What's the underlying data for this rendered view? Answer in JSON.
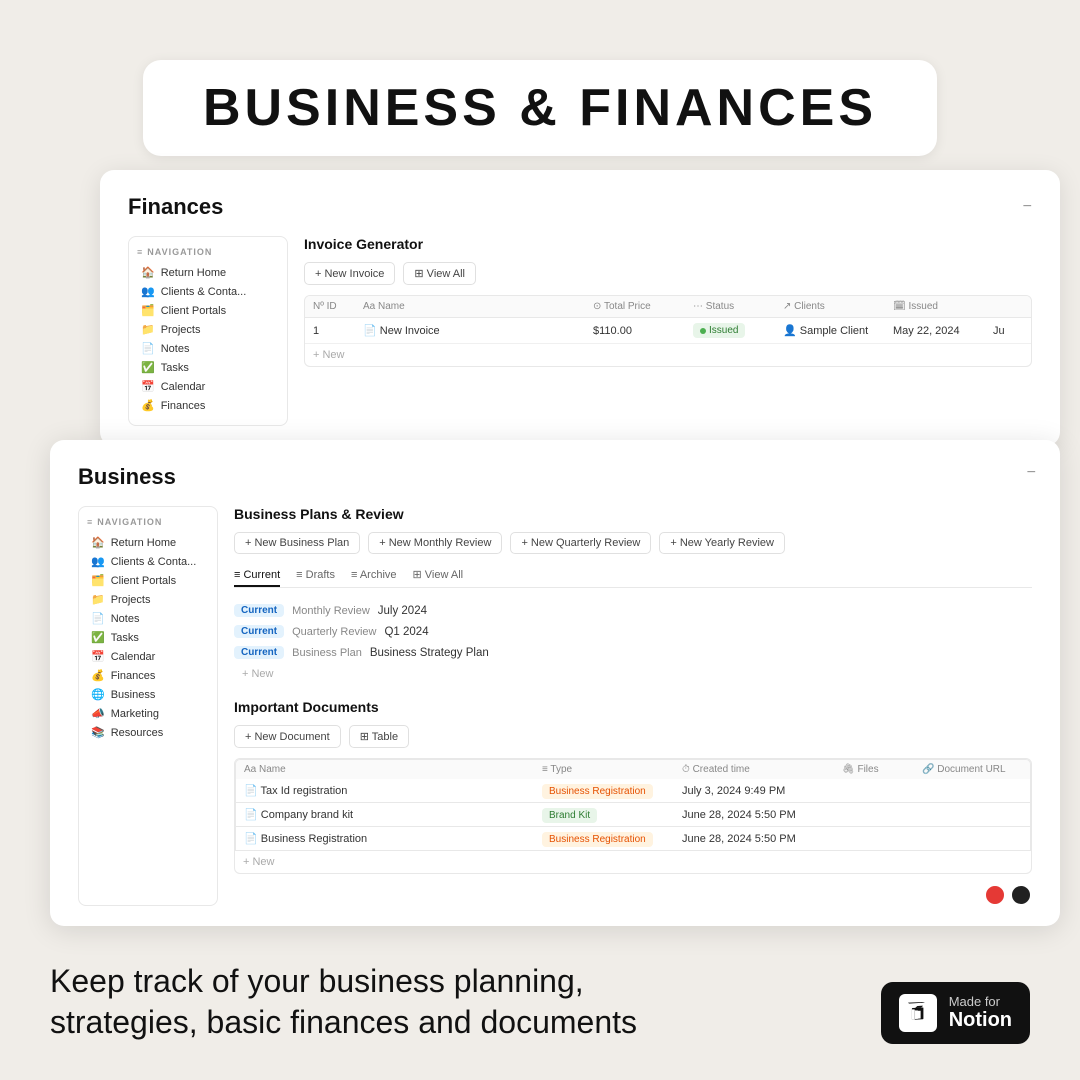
{
  "hero": {
    "title": "BUSINESS & FINANCES"
  },
  "finance_card": {
    "page_title": "Finances",
    "section_title": "Invoice Generator",
    "nav_label": "NAVIGATION",
    "sidebar_items": [
      {
        "icon": "🏠",
        "label": "Return Home"
      },
      {
        "icon": "👥",
        "label": "Clients & Conta..."
      },
      {
        "icon": "🗂️",
        "label": "Client Portals"
      },
      {
        "icon": "📁",
        "label": "Projects"
      },
      {
        "icon": "📄",
        "label": "Notes"
      },
      {
        "icon": "✅",
        "label": "Tasks"
      },
      {
        "icon": "📅",
        "label": "Calendar"
      },
      {
        "icon": "💰",
        "label": "Finances"
      }
    ],
    "toolbar": {
      "new_invoice": "+ New Invoice",
      "view_all": "⊞ View All"
    },
    "table": {
      "headers": [
        "Nº ID",
        "Aa Name",
        "⊙ Total Price",
        "⋯ Status",
        "↗ Clients",
        "🗓 Issued",
        ""
      ],
      "rows": [
        {
          "id": "1",
          "name": "New Invoice",
          "price": "$110.00",
          "status": "Issued",
          "client": "Sample Client",
          "issued": "May 22, 2024",
          "extra": "Ju"
        }
      ],
      "new_row": "+ New"
    }
  },
  "business_card": {
    "page_title": "Business",
    "section_title": "Business Plans & Review",
    "nav_label": "NAVIGATION",
    "sidebar_items": [
      {
        "icon": "🏠",
        "label": "Return Home"
      },
      {
        "icon": "👥",
        "label": "Clients & Conta..."
      },
      {
        "icon": "🗂️",
        "label": "Client Portals"
      },
      {
        "icon": "📁",
        "label": "Projects"
      },
      {
        "icon": "📄",
        "label": "Notes"
      },
      {
        "icon": "✅",
        "label": "Tasks"
      },
      {
        "icon": "📅",
        "label": "Calendar"
      },
      {
        "icon": "💰",
        "label": "Finances"
      },
      {
        "icon": "🌐",
        "label": "Business"
      },
      {
        "icon": "📣",
        "label": "Marketing"
      },
      {
        "icon": "📚",
        "label": "Resources"
      }
    ],
    "toolbar": {
      "new_business_plan": "+ New Business Plan",
      "new_monthly": "+ New Monthly Review",
      "new_quarterly": "+ New Quarterly Review",
      "new_yearly": "+ New Yearly Review"
    },
    "tabs": [
      {
        "label": "Current",
        "active": true
      },
      {
        "label": "Drafts",
        "active": false
      },
      {
        "label": "Archive",
        "active": false
      },
      {
        "label": "⊞ View All",
        "active": false
      }
    ],
    "plans": [
      {
        "badge": "Current",
        "type": "Monthly Review",
        "title": "July 2024"
      },
      {
        "badge": "Current",
        "type": "Quarterly Review",
        "title": "Q1 2024"
      },
      {
        "badge": "Current",
        "type": "Business Plan",
        "title": "Business Strategy Plan"
      }
    ],
    "new_plan": "+ New",
    "docs_section": {
      "title": "Important Documents",
      "new_doc_btn": "+ New Document",
      "table_label": "Table",
      "headers": [
        "Aa Name",
        "≡ Type",
        "⏱ Created time",
        "🖇 Files",
        "🔗 Document URL"
      ],
      "rows": [
        {
          "name": "Tax Id registration",
          "type": "Business Registration",
          "type_style": "biz",
          "created": "July 3, 2024 9:49 PM"
        },
        {
          "name": "Company brand kit",
          "type": "Brand Kit",
          "type_style": "brand",
          "created": "June 28, 2024 5:50 PM"
        },
        {
          "name": "Business Registration",
          "type": "Business Registration",
          "type_style": "biz",
          "created": "June 28, 2024 5:50 PM"
        }
      ],
      "new_row": "+ New"
    }
  },
  "footer": {
    "text": "Keep track of your business planning,\nstrategies, basic finances and documents",
    "notion_badge": {
      "made_for": "Made for",
      "notion": "Notion",
      "n_letter": "N"
    }
  }
}
